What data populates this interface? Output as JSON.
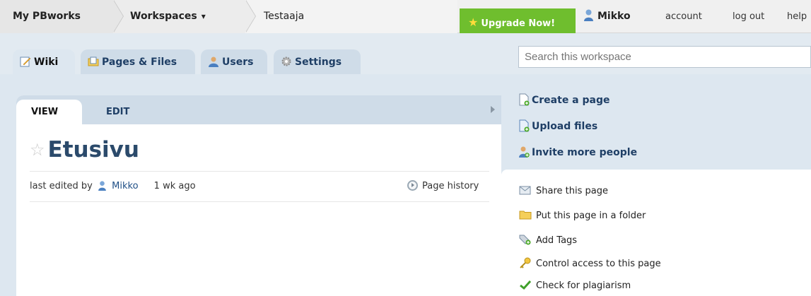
{
  "topbar": {
    "home_label": "My PBworks",
    "workspaces_label": "Workspaces",
    "workspace_name": "Testaaja",
    "upgrade_label": "Upgrade Now!",
    "user_name": "Mikko",
    "account_label": "account",
    "logout_label": "log out",
    "help_label": "help"
  },
  "tabs": [
    {
      "label": "Wiki",
      "icon": "wiki-edit-icon",
      "active": true
    },
    {
      "label": "Pages & Files",
      "icon": "folder-page-icon",
      "active": false
    },
    {
      "label": "Users",
      "icon": "users-icon",
      "active": false
    },
    {
      "label": "Settings",
      "icon": "gear-icon",
      "active": false
    }
  ],
  "search": {
    "placeholder": "Search this workspace"
  },
  "page": {
    "subtabs": {
      "view": "VIEW",
      "edit": "EDIT"
    },
    "title": "Etusivu",
    "meta": {
      "last_edited_by": "last edited by",
      "editor": "Mikko",
      "ago": "1 wk ago"
    },
    "history_label": "Page history"
  },
  "actions": [
    {
      "label": "Create a page",
      "icon": "new-page-icon"
    },
    {
      "label": "Upload files",
      "icon": "upload-icon"
    },
    {
      "label": "Invite more people",
      "icon": "invite-users-icon"
    }
  ],
  "side_links": [
    {
      "label": "Share this page",
      "icon": "share-envelope-icon"
    },
    {
      "label": "Put this page in a folder",
      "icon": "folder-icon"
    },
    {
      "label": "Add Tags",
      "icon": "tag-add-icon"
    },
    {
      "label": "Control access to this page",
      "icon": "key-icon"
    },
    {
      "label": "Check for plagiarism",
      "icon": "checkmark-icon"
    }
  ],
  "colors": {
    "accent_blue": "#1f3f66",
    "upgrade_green": "#6fbe2e",
    "panel_bg": "#dde7f0"
  }
}
